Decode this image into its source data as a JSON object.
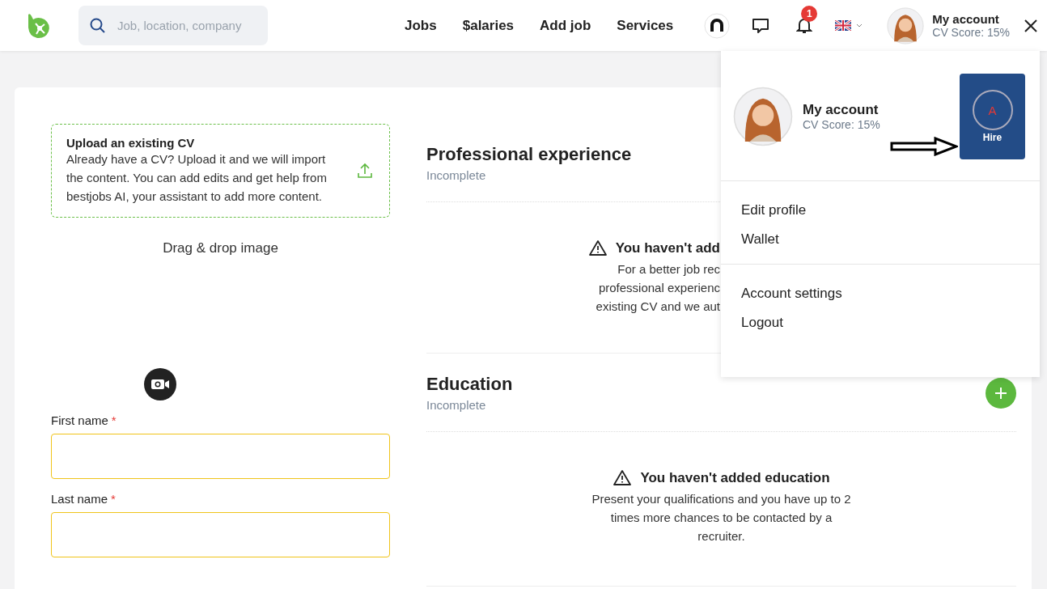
{
  "header": {
    "search": {
      "placeholder": "Job, location, company"
    },
    "nav": [
      "Jobs",
      "$alaries",
      "Add job",
      "Services"
    ],
    "notifications": {
      "badge": "1"
    },
    "account": {
      "name": "My account",
      "score": "CV Score: 15%"
    }
  },
  "upload": {
    "title": "Upload an existing CV",
    "text": "Already have a CV? Upload it and we will import the content. You can add edits and get help from bestjobs AI, your assistant to add more content."
  },
  "drag_drop": "Drag & drop image",
  "form": {
    "fields": [
      {
        "label": "First name",
        "required_mark": "*"
      },
      {
        "label": "Last name",
        "required_mark": "*"
      }
    ]
  },
  "sections": [
    {
      "title": "Professional experience",
      "status": "Incomplete",
      "empty_title": "You haven't add",
      "empty_lines": [
        "For a better job rec",
        "professional experienc",
        "existing CV and we aut"
      ]
    },
    {
      "title": "Education",
      "status": "Incomplete",
      "add_button": true,
      "empty_title": "You haven't added education",
      "empty_lines": [
        "Present your qualifications and you have up to 2",
        "times more chances to be contacted by a",
        "recruiter."
      ]
    }
  ],
  "dropdown": {
    "name": "My account",
    "score": "CV Score: 15%",
    "hire": {
      "letter": "A",
      "label": "Hire"
    },
    "groups": [
      [
        "Edit profile",
        "Wallet"
      ],
      [
        "Account settings",
        "Logout"
      ]
    ]
  }
}
